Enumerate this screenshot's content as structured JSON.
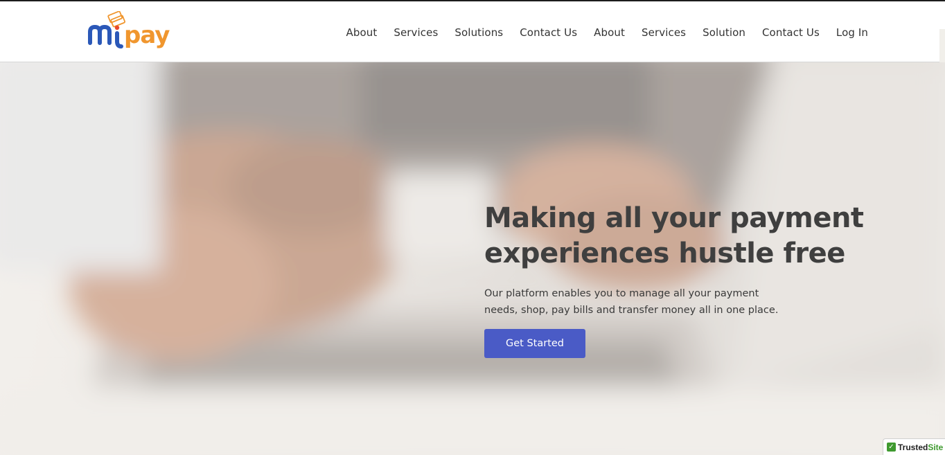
{
  "brand": {
    "logo_text": "mipay",
    "colors": {
      "blue": "#2b58b8",
      "orange": "#f0962e",
      "accent_button": "#4a5bc6"
    }
  },
  "nav": {
    "items": [
      {
        "label": "About"
      },
      {
        "label": "Services"
      },
      {
        "label": "Solutions"
      },
      {
        "label": "Contact Us"
      },
      {
        "label": "About"
      },
      {
        "label": "Services"
      },
      {
        "label": "Solution"
      },
      {
        "label": "Contact Us"
      },
      {
        "label": "Log In"
      }
    ]
  },
  "hero": {
    "background_image": "blurred-hands-typing-on-laptop",
    "title_line1": "Making all your payment",
    "title_line2": "experiences hustle free",
    "description_line1": "Our platform enables you to manage all your payment",
    "description_line2": "needs, shop, pay bills and transfer money all in one place.",
    "cta_label": "Get Started"
  },
  "badge": {
    "check_glyph": "✓",
    "label_main": "Trusted",
    "label_suffix": "Site"
  }
}
